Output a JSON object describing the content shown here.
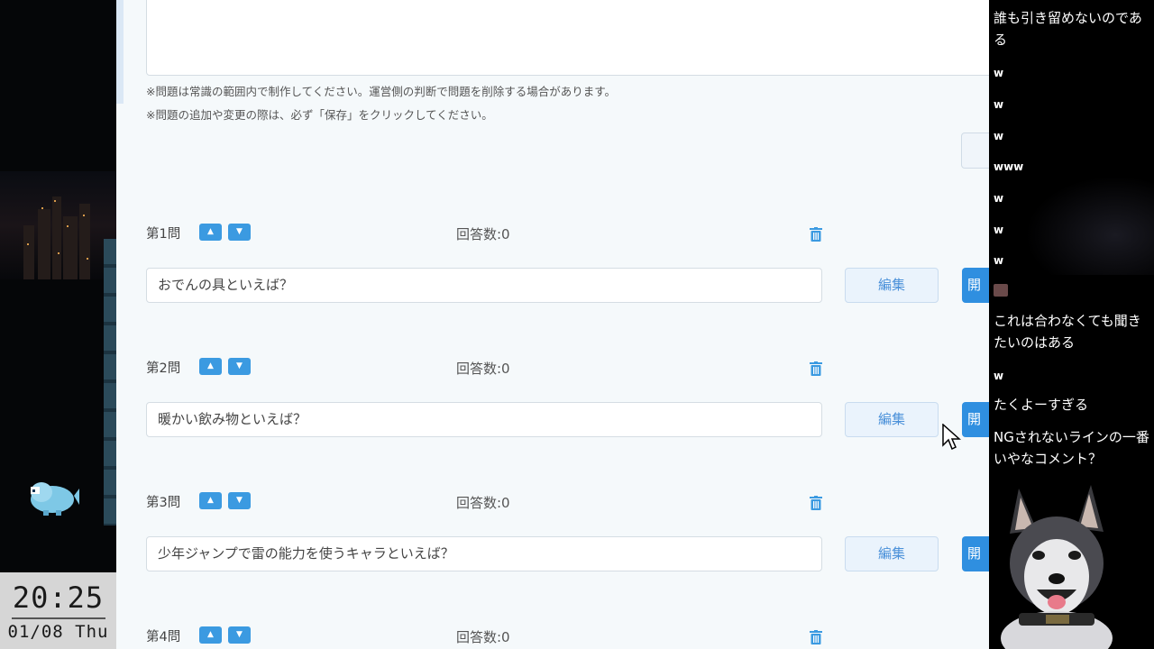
{
  "clock": {
    "time": "20:25",
    "date": "01/08 Thu"
  },
  "page": {
    "notes": [
      "※問題は常識の範囲内で制作してください。運営側の判断で問題を削除する場合があります。",
      "※問題の追加や変更の際は、必ず「保存」をクリックしてください。"
    ],
    "edit_label": "編集",
    "open_label": "開",
    "questions": [
      {
        "number": "第1問",
        "answers": "回答数:0",
        "text": "おでんの具といえば？"
      },
      {
        "number": "第2問",
        "answers": "回答数:0",
        "text": "暖かい飲み物といえば？"
      },
      {
        "number": "第3問",
        "answers": "回答数:0",
        "text": "少年ジャンプで雷の能力を使うキャラといえば？"
      },
      {
        "number": "第4問",
        "answers": "回答数:0",
        "text": ""
      }
    ],
    "colors": {
      "accent": "#3b9ae1",
      "edit_bg": "#eaf3fc",
      "page_bg": "#f5f9fb"
    }
  },
  "comments": [
    "誰も引き留めないのである",
    "w",
    "w",
    "w",
    "www",
    "w",
    "w",
    "w",
    "",
    "これは合わなくても聞きたいのはある",
    "w",
    "たくよーすぎる",
    "NGされないラインの一番いやなコメント？"
  ]
}
